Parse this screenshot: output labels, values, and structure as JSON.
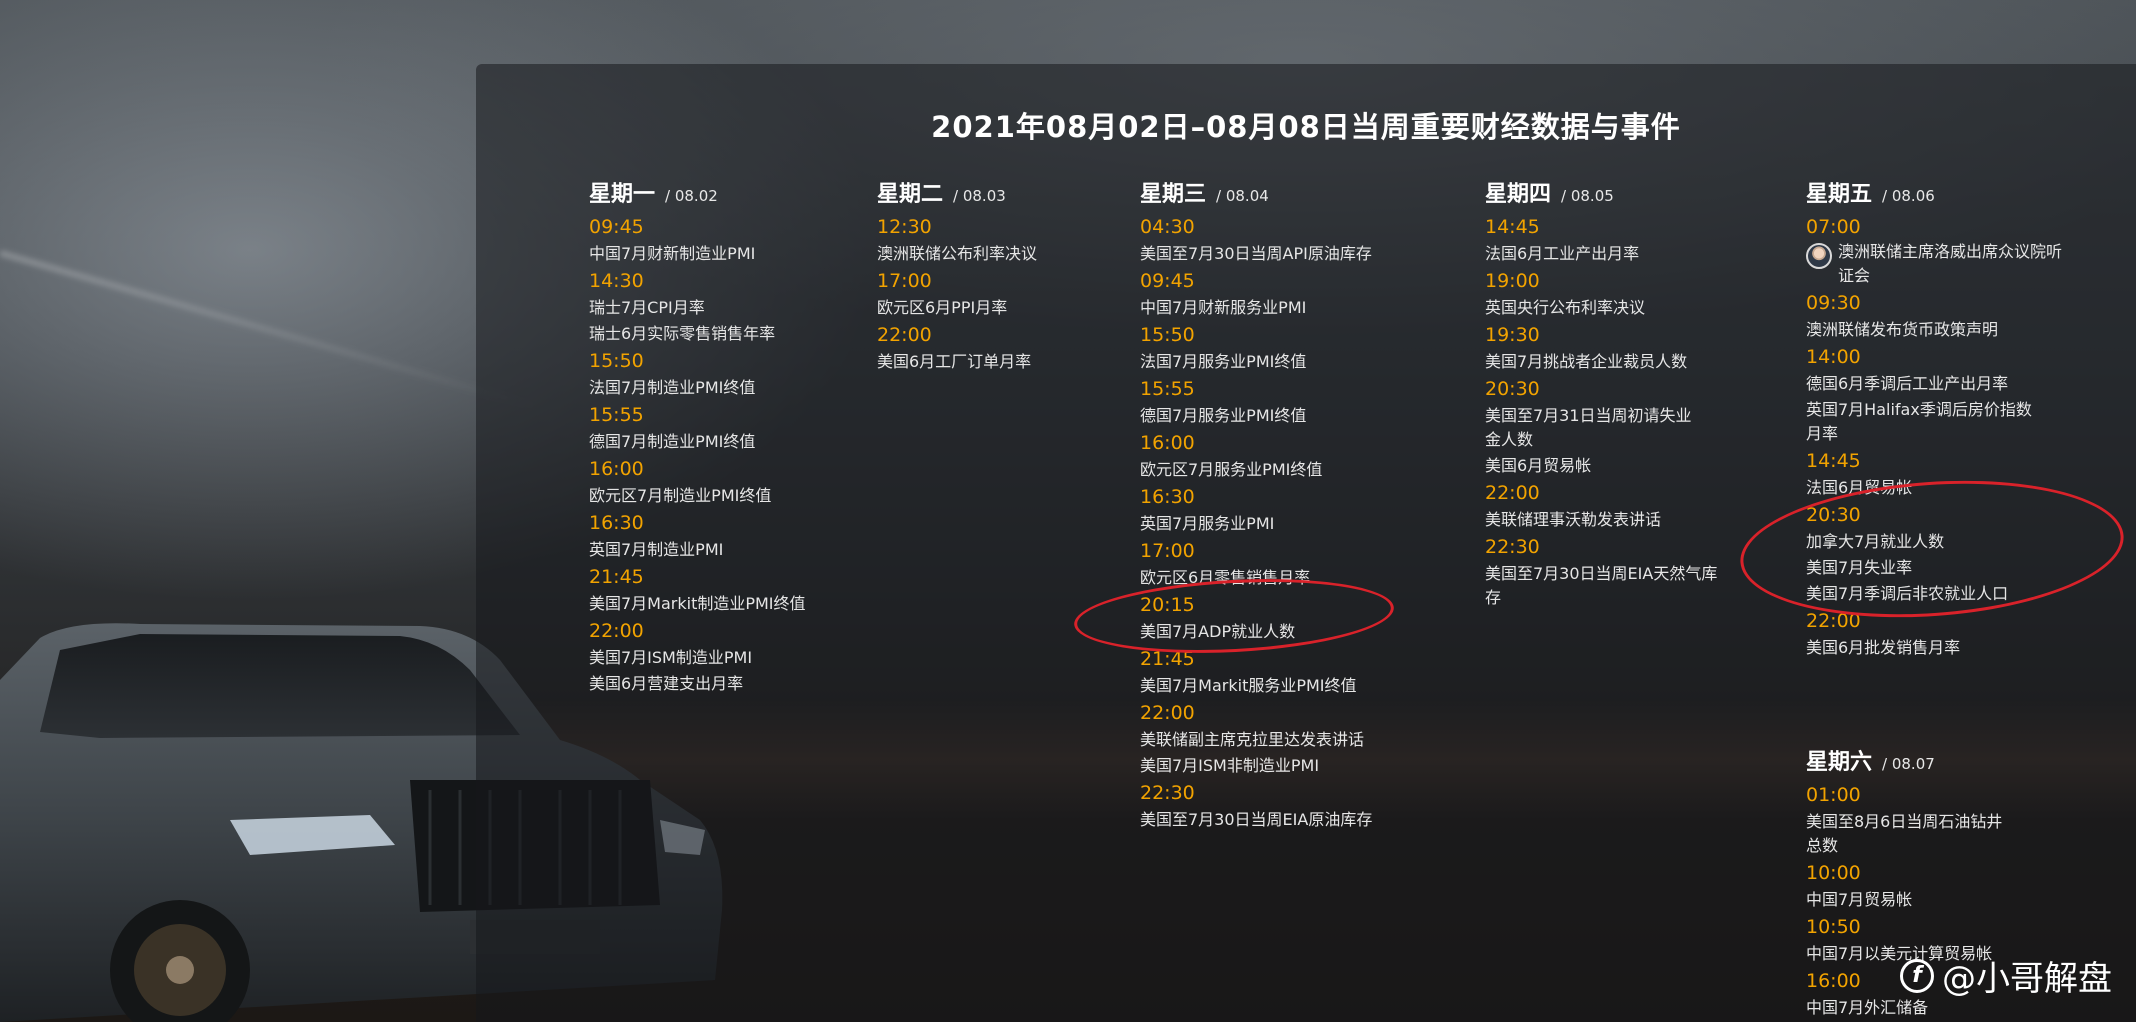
{
  "title": "2021年08月02日–08月08日当周重要财经数据与事件",
  "days": [
    {
      "name": "星期一",
      "date": "/ 08.02",
      "entries": [
        {
          "time": "09:45",
          "events": [
            "中国7月财新制造业PMI"
          ]
        },
        {
          "time": "14:30",
          "events": [
            "瑞士7月CPI月率",
            "瑞士6月实际零售销售年率"
          ]
        },
        {
          "time": "15:50",
          "events": [
            "法国7月制造业PMI终值"
          ]
        },
        {
          "time": "15:55",
          "events": [
            "德国7月制造业PMI终值"
          ]
        },
        {
          "time": "16:00",
          "events": [
            "欧元区7月制造业PMI终值"
          ]
        },
        {
          "time": "16:30",
          "events": [
            "英国7月制造业PMI"
          ]
        },
        {
          "time": "21:45",
          "events": [
            "美国7月Markit制造业PMI终值"
          ]
        },
        {
          "time": "22:00",
          "events": [
            "美国7月ISM制造业PMI",
            "美国6月营建支出月率"
          ]
        }
      ]
    },
    {
      "name": "星期二",
      "date": "/ 08.03",
      "entries": [
        {
          "time": "12:30",
          "events": [
            "澳洲联储公布利率决议"
          ]
        },
        {
          "time": "17:00",
          "events": [
            "欧元区6月PPI月率"
          ]
        },
        {
          "time": "22:00",
          "events": [
            "美国6月工厂订单月率"
          ]
        }
      ]
    },
    {
      "name": "星期三",
      "date": "/ 08.04",
      "entries": [
        {
          "time": "04:30",
          "events": [
            "美国至7月30日当周API原油库存"
          ]
        },
        {
          "time": "09:45",
          "events": [
            "中国7月财新服务业PMI"
          ]
        },
        {
          "time": "15:50",
          "events": [
            "法国7月服务业PMI终值"
          ]
        },
        {
          "time": "15:55",
          "events": [
            "德国7月服务业PMI终值"
          ]
        },
        {
          "time": "16:00",
          "events": [
            "欧元区7月服务业PMI终值"
          ]
        },
        {
          "time": "16:30",
          "events": [
            "英国7月服务业PMI"
          ]
        },
        {
          "time": "17:00",
          "events": [
            "欧元区6月零售销售月率"
          ]
        },
        {
          "time": "20:15",
          "events": [
            "美国7月ADP就业人数"
          ]
        },
        {
          "time": "21:45",
          "events": [
            "美国7月Markit服务业PMI终值"
          ]
        },
        {
          "time": "22:00",
          "events": [
            "美联储副主席克拉里达发表讲话",
            "美国7月ISM非制造业PMI"
          ]
        },
        {
          "time": "22:30",
          "events": [
            "美国至7月30日当周EIA原油库存"
          ]
        }
      ]
    },
    {
      "name": "星期四",
      "date": "/ 08.05",
      "entries": [
        {
          "time": "14:45",
          "events": [
            "法国6月工业产出月率"
          ]
        },
        {
          "time": "19:00",
          "events": [
            "英国央行公布利率决议"
          ]
        },
        {
          "time": "19:30",
          "events": [
            "美国7月挑战者企业裁员人数"
          ]
        },
        {
          "time": "20:30",
          "events": [
            "美国至7月31日当周初请失业金人数",
            "美国6月贸易帐"
          ]
        },
        {
          "time": "22:00",
          "events": [
            "美联储理事沃勒发表讲话"
          ]
        },
        {
          "time": "22:30",
          "events": [
            "美国至7月30日当周EIA天然气库存"
          ]
        }
      ]
    },
    {
      "name": "星期五",
      "date": "/ 08.06",
      "entries": [
        {
          "time": "07:00",
          "events": [
            "澳洲联储主席洛威出席众议院听证会"
          ]
        },
        {
          "time": "09:30",
          "events": [
            "澳洲联储发布货币政策声明"
          ]
        },
        {
          "time": "14:00",
          "events": [
            "德国6月季调后工业产出月率",
            "英国7月Halifax季调后房价指数月率"
          ]
        },
        {
          "time": "14:45",
          "events": [
            "法国6月贸易帐"
          ]
        },
        {
          "time": "20:30",
          "events": [
            "加拿大7月就业人数",
            "美国7月失业率",
            "美国7月季调后非农就业人口"
          ]
        },
        {
          "time": "22:00",
          "events": [
            "美国6月批发销售月率"
          ]
        }
      ]
    },
    {
      "name": "星期六",
      "date": "/ 08.07",
      "entries": [
        {
          "time": "01:00",
          "events": [
            "美国至8月6日当周石油钻井总数"
          ]
        },
        {
          "time": "10:00",
          "events": [
            "中国7月贸易帐"
          ]
        },
        {
          "time": "10:50",
          "events": [
            "中国7月以美元计算贸易帐"
          ]
        },
        {
          "time": "16:00",
          "events": [
            "中国7月外汇储备"
          ]
        }
      ]
    }
  ],
  "highlight_color": "#d9222a",
  "time_color": "#f2a300",
  "watermark": "@小哥解盘"
}
